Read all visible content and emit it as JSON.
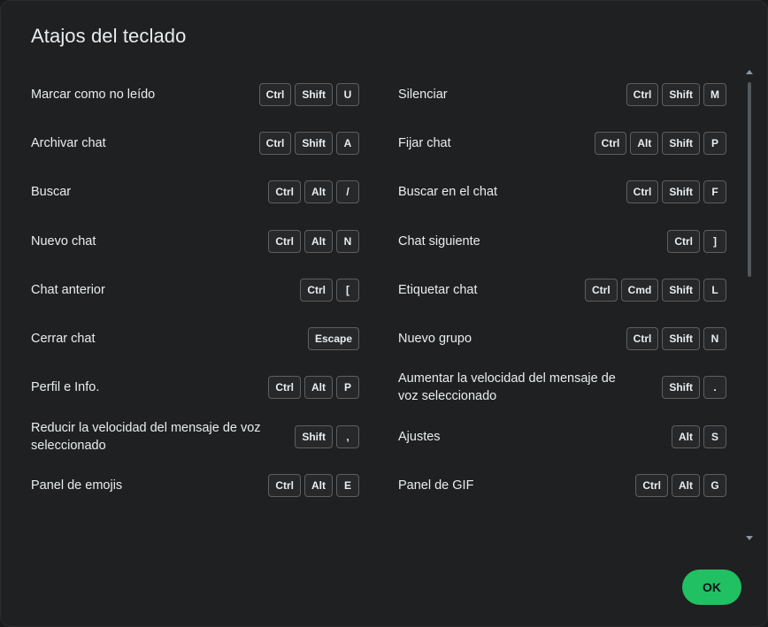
{
  "dialog": {
    "title": "Atajos del teclado",
    "ok_label": "OK"
  },
  "shortcuts": [
    {
      "label": "Marcar como no leído",
      "keys": [
        "Ctrl",
        "Shift",
        "U"
      ]
    },
    {
      "label": "Silenciar",
      "keys": [
        "Ctrl",
        "Shift",
        "M"
      ]
    },
    {
      "label": "Archivar chat",
      "keys": [
        "Ctrl",
        "Shift",
        "A"
      ]
    },
    {
      "label": "Fijar chat",
      "keys": [
        "Ctrl",
        "Alt",
        "Shift",
        "P"
      ]
    },
    {
      "label": "Buscar",
      "keys": [
        "Ctrl",
        "Alt",
        "/"
      ]
    },
    {
      "label": "Buscar en el chat",
      "keys": [
        "Ctrl",
        "Shift",
        "F"
      ]
    },
    {
      "label": "Nuevo chat",
      "keys": [
        "Ctrl",
        "Alt",
        "N"
      ]
    },
    {
      "label": "Chat siguiente",
      "keys": [
        "Ctrl",
        "]"
      ]
    },
    {
      "label": "Chat anterior",
      "keys": [
        "Ctrl",
        "["
      ]
    },
    {
      "label": "Etiquetar chat",
      "keys": [
        "Ctrl",
        "Cmd",
        "Shift",
        "L"
      ]
    },
    {
      "label": "Cerrar chat",
      "keys": [
        "Escape"
      ]
    },
    {
      "label": "Nuevo grupo",
      "keys": [
        "Ctrl",
        "Shift",
        "N"
      ]
    },
    {
      "label": "Perfil e Info.",
      "keys": [
        "Ctrl",
        "Alt",
        "P"
      ]
    },
    {
      "label": "Aumentar la velocidad del mensaje de voz seleccionado",
      "keys": [
        "Shift",
        "."
      ]
    },
    {
      "label": "Reducir la velocidad del mensaje de voz seleccionado",
      "keys": [
        "Shift",
        ","
      ]
    },
    {
      "label": "Ajustes",
      "keys": [
        "Alt",
        "S"
      ]
    },
    {
      "label": "Panel de emojis",
      "keys": [
        "Ctrl",
        "Alt",
        "E"
      ]
    },
    {
      "label": "Panel de GIF",
      "keys": [
        "Ctrl",
        "Alt",
        "G"
      ]
    }
  ]
}
